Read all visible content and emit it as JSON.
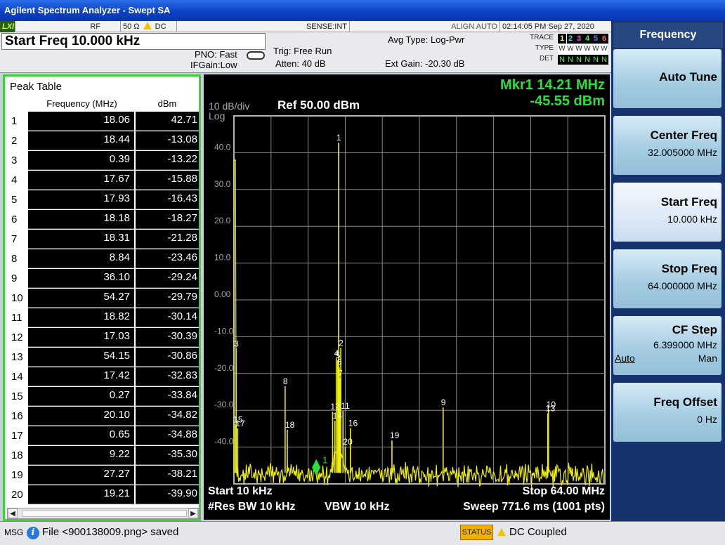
{
  "window": {
    "title": "Agilent Spectrum Analyzer - Swept SA"
  },
  "status_row": {
    "lxi": "LXI",
    "rf": "RF",
    "impedance": "50 Ω",
    "coupling": "DC",
    "sense": "SENSE:INT",
    "align": "ALIGN AUTO",
    "datetime": "02:14:05 PM Sep 27, 2020"
  },
  "header": {
    "start_freq": "Start Freq 10.000 kHz",
    "pno": "PNO: Fast",
    "ifgain": "IFGain:Low",
    "trig": "Trig: Free Run",
    "atten": "Atten: 40 dB",
    "avg_type": "Avg Type: Log-Pwr",
    "ext_gain": "Ext Gain: -20.30 dB",
    "trace_label": "TRACE",
    "type_label": "TYPE",
    "det_label": "DET",
    "trace_digits": [
      "1",
      "2",
      "3",
      "4",
      "5",
      "6"
    ],
    "type_chars": [
      "W",
      "W",
      "W",
      "W",
      "W",
      "W"
    ],
    "det_chars": [
      "N",
      "N",
      "N",
      "N",
      "N",
      "N"
    ]
  },
  "peak_table": {
    "title": "Peak Table",
    "col_freq": "Frequency (MHz)",
    "col_dbm": "dBm",
    "rows": [
      {
        "idx": "1",
        "freq": "18.06",
        "dbm": "42.71"
      },
      {
        "idx": "2",
        "freq": "18.44",
        "dbm": "-13.08"
      },
      {
        "idx": "3",
        "freq": "0.39",
        "dbm": "-13.22"
      },
      {
        "idx": "4",
        "freq": "17.67",
        "dbm": "-15.88"
      },
      {
        "idx": "5",
        "freq": "17.93",
        "dbm": "-16.43"
      },
      {
        "idx": "6",
        "freq": "18.18",
        "dbm": "-18.27"
      },
      {
        "idx": "7",
        "freq": "18.31",
        "dbm": "-21.28"
      },
      {
        "idx": "8",
        "freq": "8.84",
        "dbm": "-23.46"
      },
      {
        "idx": "9",
        "freq": "36.10",
        "dbm": "-29.24"
      },
      {
        "idx": "10",
        "freq": "54.27",
        "dbm": "-29.79"
      },
      {
        "idx": "11",
        "freq": "18.82",
        "dbm": "-30.14"
      },
      {
        "idx": "12",
        "freq": "17.03",
        "dbm": "-30.39"
      },
      {
        "idx": "13",
        "freq": "54.15",
        "dbm": "-30.86"
      },
      {
        "idx": "14",
        "freq": "17.42",
        "dbm": "-32.83"
      },
      {
        "idx": "15",
        "freq": "0.27",
        "dbm": "-33.84"
      },
      {
        "idx": "16",
        "freq": "20.10",
        "dbm": "-34.82"
      },
      {
        "idx": "17",
        "freq": "0.65",
        "dbm": "-34.88"
      },
      {
        "idx": "18",
        "freq": "9.22",
        "dbm": "-35.30"
      },
      {
        "idx": "19",
        "freq": "27.27",
        "dbm": "-38.21"
      },
      {
        "idx": "20",
        "freq": "19.21",
        "dbm": "-39.90"
      }
    ]
  },
  "display": {
    "scale": "10 dB/div",
    "scale_type": "Log",
    "ref": "Ref 50.00 dBm",
    "marker_freq": "Mkr1 14.21 MHz",
    "marker_level": "-45.55 dBm",
    "start": "Start 10 kHz",
    "stop": "Stop 64.00 MHz",
    "rbw": "#Res BW 10 kHz",
    "vbw": "VBW 10 kHz",
    "sweep": "Sweep  771.6 ms (1001 pts)",
    "marker_number": "1"
  },
  "chart_data": {
    "type": "line",
    "xlabel": "",
    "ylabel": "",
    "x_range_mhz": [
      0.01,
      64.0
    ],
    "ylim": [
      -50,
      50
    ],
    "y_ticks": [
      "40.0",
      "30.0",
      "20.0",
      "10.0",
      "0.00",
      "-10.0",
      "-20.0",
      "-30.0",
      "-40.0"
    ],
    "grid": true,
    "noise_floor_dbm": -47,
    "peaks": [
      {
        "label": "1",
        "freq_mhz": 18.06,
        "dbm": 42.71
      },
      {
        "label": "2",
        "freq_mhz": 18.44,
        "dbm": -13.08
      },
      {
        "label": "3",
        "freq_mhz": 0.39,
        "dbm": -13.22
      },
      {
        "label": "4",
        "freq_mhz": 17.67,
        "dbm": -15.88
      },
      {
        "label": "5",
        "freq_mhz": 17.93,
        "dbm": -16.43
      },
      {
        "label": "6",
        "freq_mhz": 18.18,
        "dbm": -18.27
      },
      {
        "label": "7",
        "freq_mhz": 18.31,
        "dbm": -21.28
      },
      {
        "label": "8",
        "freq_mhz": 8.84,
        "dbm": -23.46
      },
      {
        "label": "9",
        "freq_mhz": 36.1,
        "dbm": -29.24
      },
      {
        "label": "10",
        "freq_mhz": 54.27,
        "dbm": -29.79
      },
      {
        "label": "11",
        "freq_mhz": 18.82,
        "dbm": -30.14
      },
      {
        "label": "12",
        "freq_mhz": 17.03,
        "dbm": -30.39
      },
      {
        "label": "13",
        "freq_mhz": 54.15,
        "dbm": -30.86
      },
      {
        "label": "14",
        "freq_mhz": 17.42,
        "dbm": -32.83
      },
      {
        "label": "15",
        "freq_mhz": 0.27,
        "dbm": -33.84
      },
      {
        "label": "16",
        "freq_mhz": 20.1,
        "dbm": -34.82
      },
      {
        "label": "17",
        "freq_mhz": 0.65,
        "dbm": -34.88
      },
      {
        "label": "18",
        "freq_mhz": 9.22,
        "dbm": -35.3
      },
      {
        "label": "19",
        "freq_mhz": 27.27,
        "dbm": -38.21
      },
      {
        "label": "20",
        "freq_mhz": 19.21,
        "dbm": -39.9
      }
    ],
    "marker": {
      "label": "1",
      "freq_mhz": 14.21,
      "dbm": -45.55
    },
    "trace_color": "#f0f000",
    "grid_color": "#8a8a8a"
  },
  "softkeys": {
    "menu_title": "Frequency",
    "keys": [
      {
        "title": "Auto Tune",
        "value": ""
      },
      {
        "title": "Center Freq",
        "value": "32.005000 MHz"
      },
      {
        "title": "Start Freq",
        "value": "10.000 kHz"
      },
      {
        "title": "Stop Freq",
        "value": "64.000000 MHz"
      },
      {
        "title": "CF Step",
        "value": "6.399000 MHz",
        "auto": "Auto",
        "man": "Man"
      },
      {
        "title": "Freq Offset",
        "value": "0 Hz"
      }
    ]
  },
  "bottom_bar": {
    "msg_label": "MSG",
    "info_glyph": "i",
    "message": "File <900138009.png> saved",
    "status_label": "STATUS",
    "status_text": "DC Coupled"
  },
  "colors": {
    "marker_green": "#28e038",
    "trace_yellow": "#f0f000",
    "softkey_panel": "#17336f"
  }
}
